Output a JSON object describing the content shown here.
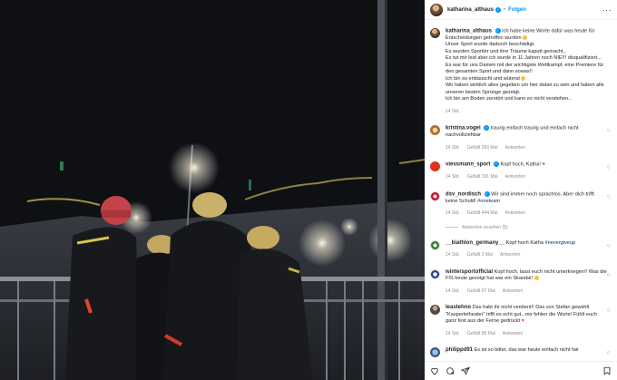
{
  "post": {
    "username": "katharina_althaus",
    "follow_label": "Folgen",
    "caption_lines": [
      "Ich habe keine Worte dafür was heute für Entscheidungen getroffen wurden",
      "Unser Sport wurde dadurch beschädigt.",
      "Es wurden Sportler und ihre Träume kaputt gemacht..",
      "Es tut mir leid aber ich wurde in 11 Jahren noch NIE!!! disqualifiziert...",
      "Es war für uns Damen mit der wichtigste Wettkampf, eine Premiere für den gesamten Sport und dann sowas!!",
      "Ich bin so enttäuscht und wütend",
      "Wir haben wirklich alles gegeben um hier dabei zu sein und haben alle unseren besten Sprünge gezeigt.",
      "Ich bin am Boden zerstört und kann es nicht verstehen.."
    ],
    "caption_time": "14 Std."
  },
  "comments": [
    {
      "user": "kristina.vogel",
      "verified": true,
      "text": "traurig einfach traurig und einfach nicht nachvollziehbar",
      "time": "14 Std.",
      "likes": "Gefällt 293 Mal",
      "reply": "Antworten",
      "avatar": "av-kv"
    },
    {
      "user": "viessmann_sport",
      "verified": true,
      "text": "Kopf hoch, Katha!",
      "heart": "♥",
      "time": "14 Std.",
      "likes": "Gefällt 191 Mal",
      "reply": "Antworten",
      "avatar": "av-vm"
    },
    {
      "user": "dsv_nordisch",
      "verified": true,
      "text": "Wir sind immer noch sprachlos. Aber dich trifft keine Schuld!",
      "hashtag": "#oneteam",
      "time": "14 Std.",
      "likes": "Gefällt 444 Mal",
      "reply": "Antworten",
      "avatar": "av-dsv",
      "replies": "Antworten ansehen (5)"
    },
    {
      "user": "__biathlon_germany__",
      "verified": false,
      "text": "Kopf hoch Katha",
      "hashtag": "#nevergiveup",
      "time": "14 Std.",
      "likes": "Gefällt 2 Mal",
      "reply": "Antworten",
      "avatar": "av-bg"
    },
    {
      "user": "wintersportofficial",
      "verified": false,
      "text": "Kopf hoch, lasst euch nicht unterkriegen!! Was die FIS heute gezeigt hat war ein Skandal!",
      "time": "14 Std.",
      "likes": "Gefällt 97 Mal",
      "reply": "Antworten",
      "avatar": "av-ws"
    },
    {
      "user": "leastehno",
      "verified": false,
      "text": "Das habt ihr nicht verdient!! Das von Stefan gewählt \"Kasperletheater\" trifft es echt gut...mir fehlen die Worte! Fühlt euch ganz fest aus der Ferne gedrückt",
      "heart": "♥",
      "time": "14 Std.",
      "likes": "Gefällt 85 Mal",
      "reply": "Antworten",
      "avatar": "av-le"
    },
    {
      "user": "philippd91",
      "verified": false,
      "text": "Es ist so bitter, das war heute einfach nicht fair",
      "time": "",
      "likes": "",
      "reply": "",
      "avatar": "av-ph"
    }
  ],
  "icons": [
    "heart-icon",
    "comment-icon",
    "share-icon",
    "bookmark-icon",
    "more-icon"
  ]
}
